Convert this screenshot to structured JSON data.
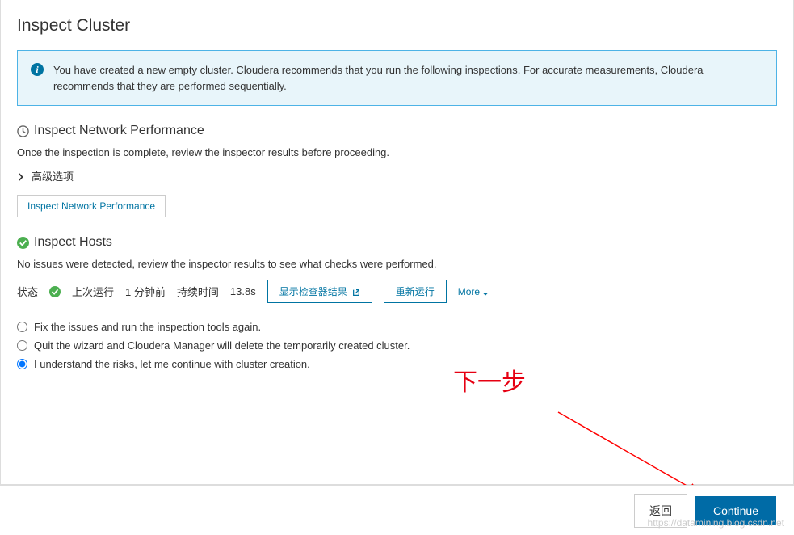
{
  "page": {
    "title": "Inspect Cluster",
    "banner_text": "You have created a new empty cluster. Cloudera recommends that you run the following inspections. For accurate measurements, Cloudera recommends that they are performed sequentially."
  },
  "network_section": {
    "heading": "Inspect Network Performance",
    "description": "Once the inspection is complete, review the inspector results before proceeding.",
    "advanced_label": "高级选项",
    "inspect_button": "Inspect Network Performance"
  },
  "hosts_section": {
    "heading": "Inspect Hosts",
    "description": "No issues were detected, review the inspector results to see what checks were performed.",
    "status_label": "状态",
    "last_run_label": "上次运行",
    "last_run_value": "1 分钟前",
    "duration_label": "持续时间",
    "duration_value": "13.8s",
    "show_results_button": "显示检查器结果",
    "rerun_button": "重新运行",
    "more_label": "More"
  },
  "options": [
    {
      "label": "Fix the issues and run the inspection tools again.",
      "selected": false
    },
    {
      "label": "Quit the wizard and Cloudera Manager will delete the temporarily created cluster.",
      "selected": false
    },
    {
      "label": "I understand the risks, let me continue with cluster creation.",
      "selected": true
    }
  ],
  "annotation": "下一步",
  "footer": {
    "back_label": "返回",
    "continue_label": "Continue"
  },
  "watermark": "https://datamining.blog.csdn.net"
}
